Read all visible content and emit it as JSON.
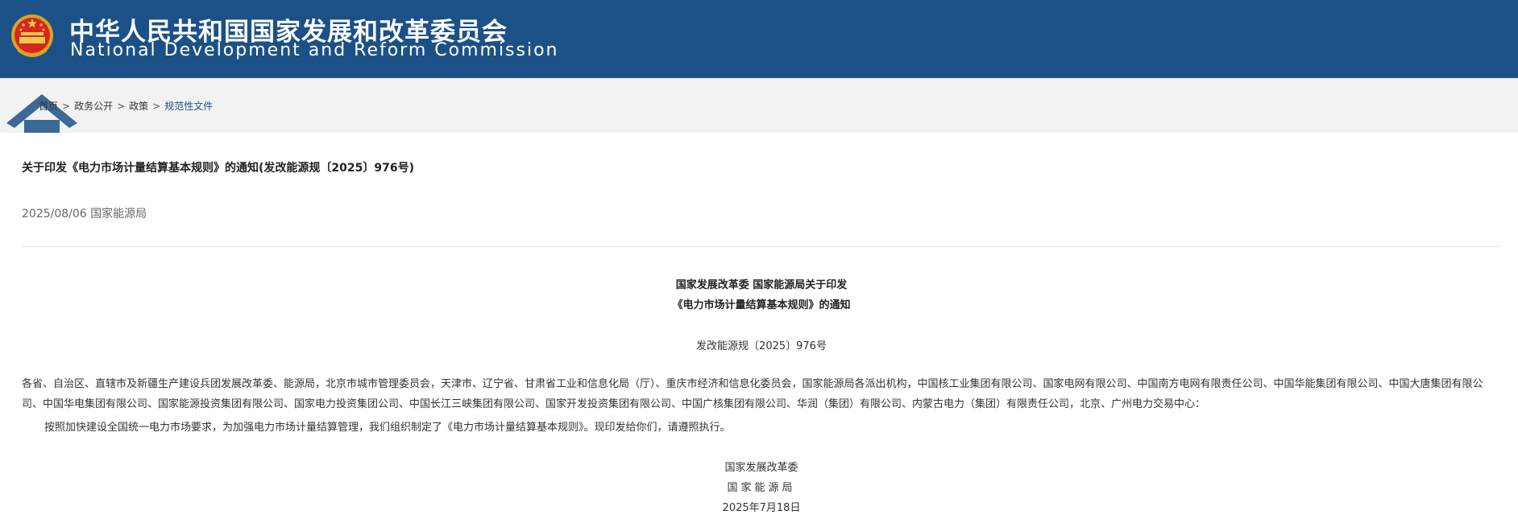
{
  "header": {
    "title_cn": "中华人民共和国国家发展和改革委员会",
    "title_en": "National Development and Reform Commission",
    "emblem_icon": "national-emblem-icon",
    "background_color": "#1c5187"
  },
  "breadcrumb": {
    "home_icon": "home-icon",
    "items": [
      "首页",
      "政务公开",
      "政策",
      "规范性文件"
    ],
    "separator": ">"
  },
  "article": {
    "title": "关于印发《电力市场计量结算基本规则》的通知(发改能源规〔2025〕976号)",
    "meta": "2025/08/06 国家能源局",
    "heading_line1": "国家发展改革委 国家能源局关于印发",
    "heading_line2": "《电力市场计量结算基本规则》的通知",
    "doc_number": "发改能源规〔2025〕976号",
    "recipients": "各省、自治区、直辖市及新疆生产建设兵团发展改革委、能源局，北京市城市管理委员会，天津市、辽宁省、甘肃省工业和信息化局（厅）、重庆市经济和信息化委员会，国家能源局各派出机构，中国核工业集团有限公司、国家电网有限公司、中国南方电网有限责任公司、中国华能集团有限公司、中国大唐集团有限公司、中国华电集团有限公司、国家能源投资集团有限公司、国家电力投资集团公司、中国长江三峡集团有限公司、国家开发投资集团有限公司、中国广核集团有限公司、华润（集团）有限公司、内蒙古电力（集团）有限责任公司，北京、广州电力交易中心：",
    "body": "按照加快建设全国统一电力市场要求，为加强电力市场计量结算管理，我们组织制定了《电力市场计量结算基本规则》。现印发给你们，请遵照执行。",
    "signer1": "国家发展改革委",
    "signer2": "国家能源局",
    "date": "2025年7月18日"
  }
}
